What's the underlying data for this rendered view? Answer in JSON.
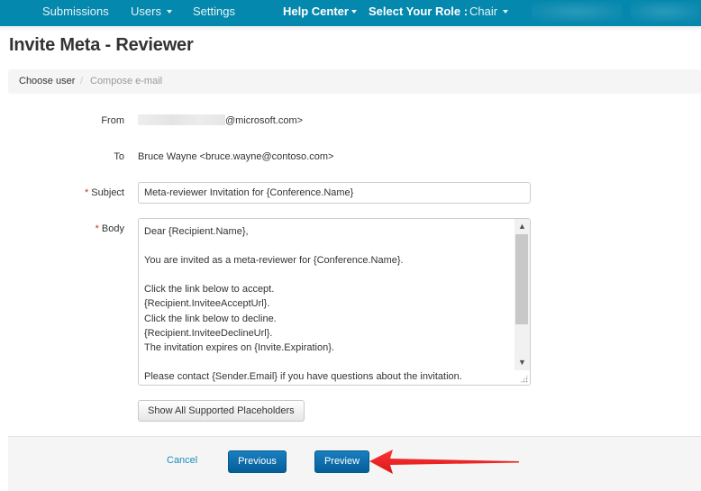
{
  "navbar": {
    "items": [
      {
        "label": "Submissions",
        "has_caret": false
      },
      {
        "label": "Users",
        "has_caret": true
      },
      {
        "label": "Settings",
        "has_caret": false
      }
    ],
    "help_center": "Help Center",
    "role_label": "Select Your Role :",
    "role_value": "Chair",
    "colors": {
      "background": "#0588ad"
    }
  },
  "page": {
    "title": "Invite Meta - Reviewer"
  },
  "breadcrumb": {
    "items": [
      "Choose user",
      "Compose e-mail"
    ],
    "separator": "/"
  },
  "form": {
    "from_label": "From",
    "from_value_suffix": "@microsoft.com>",
    "to_label": "To",
    "to_value": "Bruce Wayne <bruce.wayne@contoso.com>",
    "subject_label": "Subject",
    "subject_value": "Meta-reviewer Invitation for {Conference.Name}",
    "body_label": "Body",
    "required_marker": "*",
    "body_value": "Dear {Recipient.Name},\n\nYou are invited as a meta-reviewer for {Conference.Name}.\n\nClick the link below to accept.\n{Recipient.InviteeAcceptUrl}.\nClick the link below to decline.\n{Recipient.InviteeDeclineUrl}.\nThe invitation expires on {Invite.Expiration}.\n\nPlease contact {Sender.Email} if you have questions about the invitation.",
    "placeholders_button": "Show All Supported Placeholders"
  },
  "footer": {
    "cancel_label": "Cancel",
    "previous_label": "Previous",
    "preview_label": "Preview",
    "colors": {
      "primary": "#0b6fae",
      "link": "#1a8cbd",
      "annotation_arrow": "#e8141a"
    }
  }
}
